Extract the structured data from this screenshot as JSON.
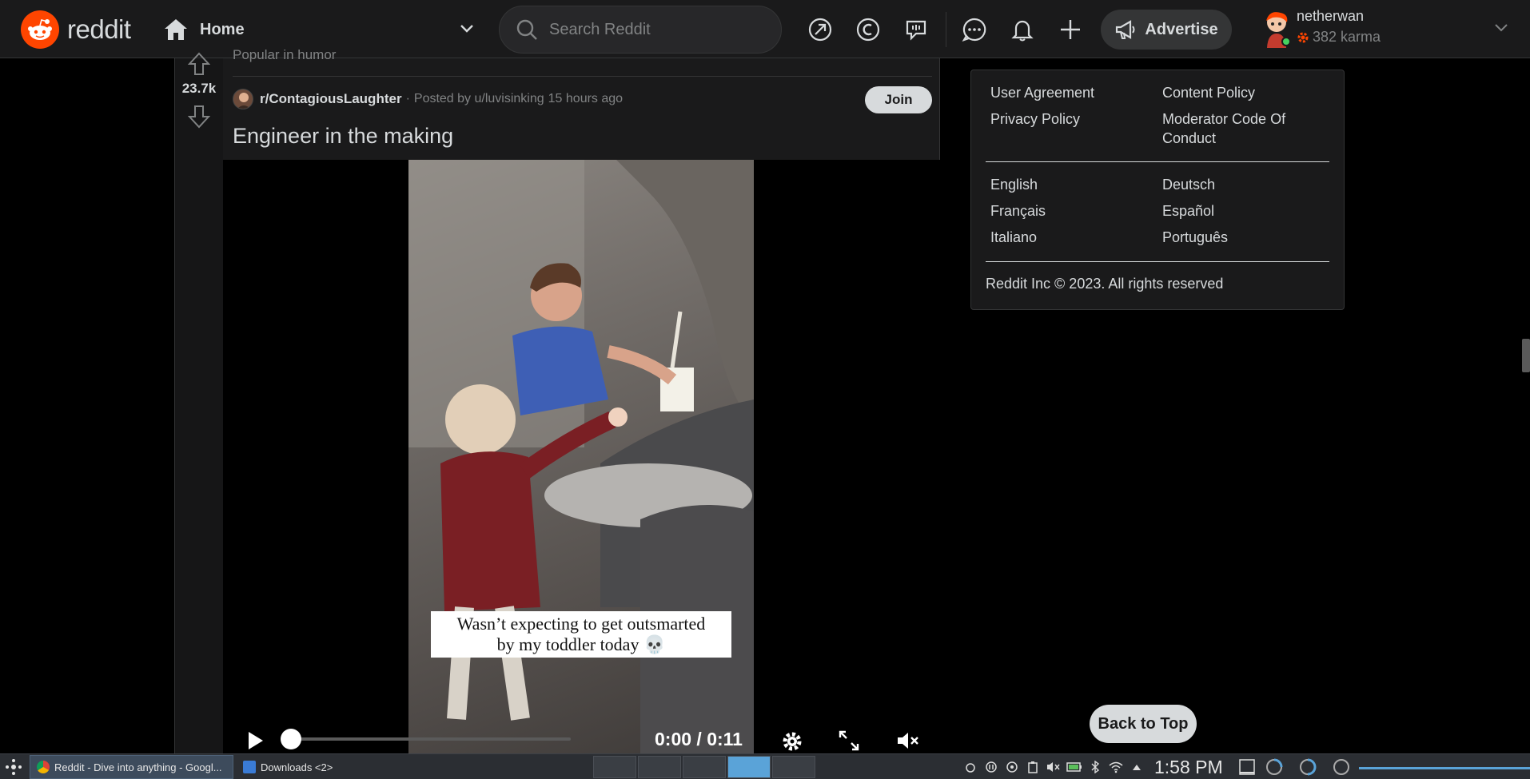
{
  "header": {
    "logo_text": "reddit",
    "feed_label": "Home",
    "search_placeholder": "Search Reddit",
    "advertise_label": "Advertise",
    "user": {
      "name": "netherwan",
      "karma": "382 karma"
    }
  },
  "post": {
    "popular_label": "Popular in humor",
    "vote_count": "23.7k",
    "subreddit": "r/ContagiousLaughter",
    "posted_by": "Posted by u/luvisinking",
    "time_ago": "15 hours ago",
    "join_label": "Join",
    "title": "Engineer in the making",
    "video": {
      "caption_line1": "Wasn’t expecting to get outsmarted",
      "caption_line2": "by my toddler today 💀",
      "time": "0:00 / 0:11",
      "progress": 0.0
    }
  },
  "sidebar": {
    "links_col1": [
      "User Agreement",
      "Privacy Policy"
    ],
    "links_col2": [
      "Content Policy",
      "Moderator Code Of",
      "Conduct"
    ],
    "languages_col1": [
      "English",
      "Français",
      "Italiano"
    ],
    "languages_col2": [
      "Deutsch",
      "Español",
      "Português"
    ],
    "copyright": "Reddit Inc © 2023. All rights reserved",
    "back_to_top": "Back to Top"
  },
  "taskbar": {
    "tasks": [
      "Reddit - Dive into anything - Googl...",
      "Downloads <2>"
    ],
    "clock": "1:58 PM"
  },
  "colors": {
    "accent": "#ff4500",
    "bg": "#000000",
    "panel": "#1a1a1b",
    "text": "#d7dadc",
    "muted": "#818384"
  }
}
